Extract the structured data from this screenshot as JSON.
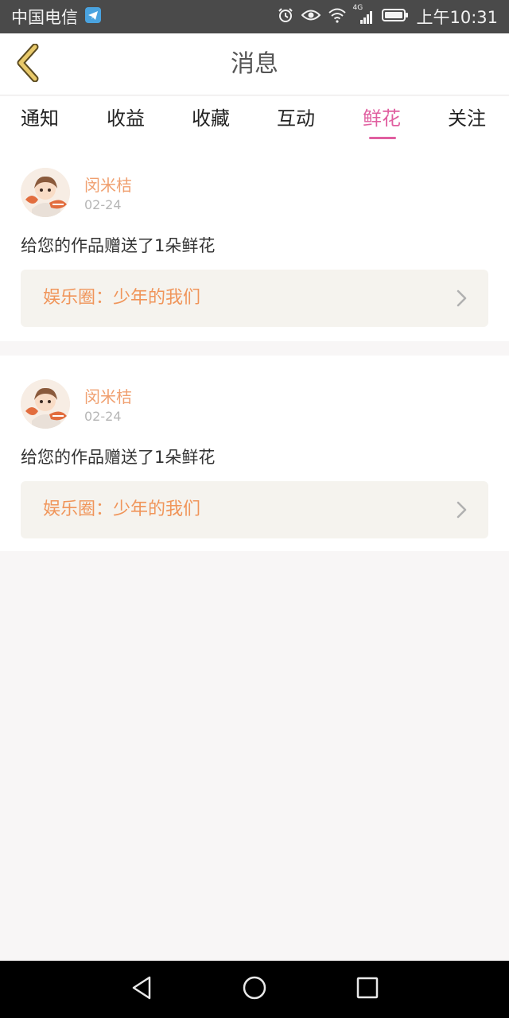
{
  "status_bar": {
    "carrier": "中国电信",
    "time": "上午10:31",
    "network": "4G",
    "icons": [
      "telegram-icon",
      "alarm-icon",
      "eye-icon",
      "wifi-icon",
      "signal-icon",
      "battery-icon"
    ]
  },
  "app_bar": {
    "title": "消息",
    "back_icon": "chevron-left-icon",
    "accent_color": "#e8c96a"
  },
  "tabs": [
    {
      "label": "通知",
      "active": false
    },
    {
      "label": "收益",
      "active": false
    },
    {
      "label": "收藏",
      "active": false
    },
    {
      "label": "互动",
      "active": false
    },
    {
      "label": "鲜花",
      "active": true
    },
    {
      "label": "关注",
      "active": false
    }
  ],
  "active_tab_color": "#e05fa0",
  "messages": [
    {
      "user_name": "闵米桔",
      "date": "02-24",
      "text": "给您的作品赠送了1朵鲜花",
      "link": "娱乐圈：少年的我们"
    },
    {
      "user_name": "闵米桔",
      "date": "02-24",
      "text": "给您的作品赠送了1朵鲜花",
      "link": "娱乐圈：少年的我们"
    }
  ],
  "nav_bar": {
    "icons": [
      "back-triangle-icon",
      "home-circle-icon",
      "recents-square-icon"
    ]
  }
}
